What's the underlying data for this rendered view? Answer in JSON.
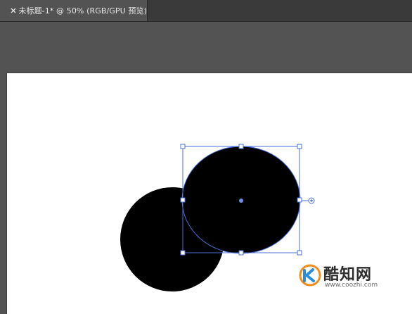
{
  "document_tab": {
    "close_glyph": "×",
    "title": "未标题-1* @ 50% (RGB/GPU 预览)"
  },
  "colors": {
    "tab_bar": "#3a3a3a",
    "tab_active": "#535353",
    "pasteboard": "#535353",
    "artboard": "#ffffff",
    "shape_fill": "#000000",
    "selection_accent": "#4a6fd6"
  },
  "canvas": {
    "shapes": [
      {
        "name": "back-circle",
        "kind": "circle",
        "fill": "#000000",
        "selected": false
      },
      {
        "name": "front-circle",
        "kind": "circle",
        "fill": "#000000",
        "selected": true
      }
    ],
    "selection": {
      "handles": [
        "top-left",
        "top-center",
        "top-right",
        "middle-left",
        "middle-right",
        "bottom-left",
        "bottom-center",
        "bottom-right"
      ],
      "center_point": true,
      "rotate_widget": true
    }
  },
  "watermark": {
    "logo_icon": "coozhi-logo-icon",
    "name": "酷知网",
    "url": "www.coozhi.com"
  }
}
